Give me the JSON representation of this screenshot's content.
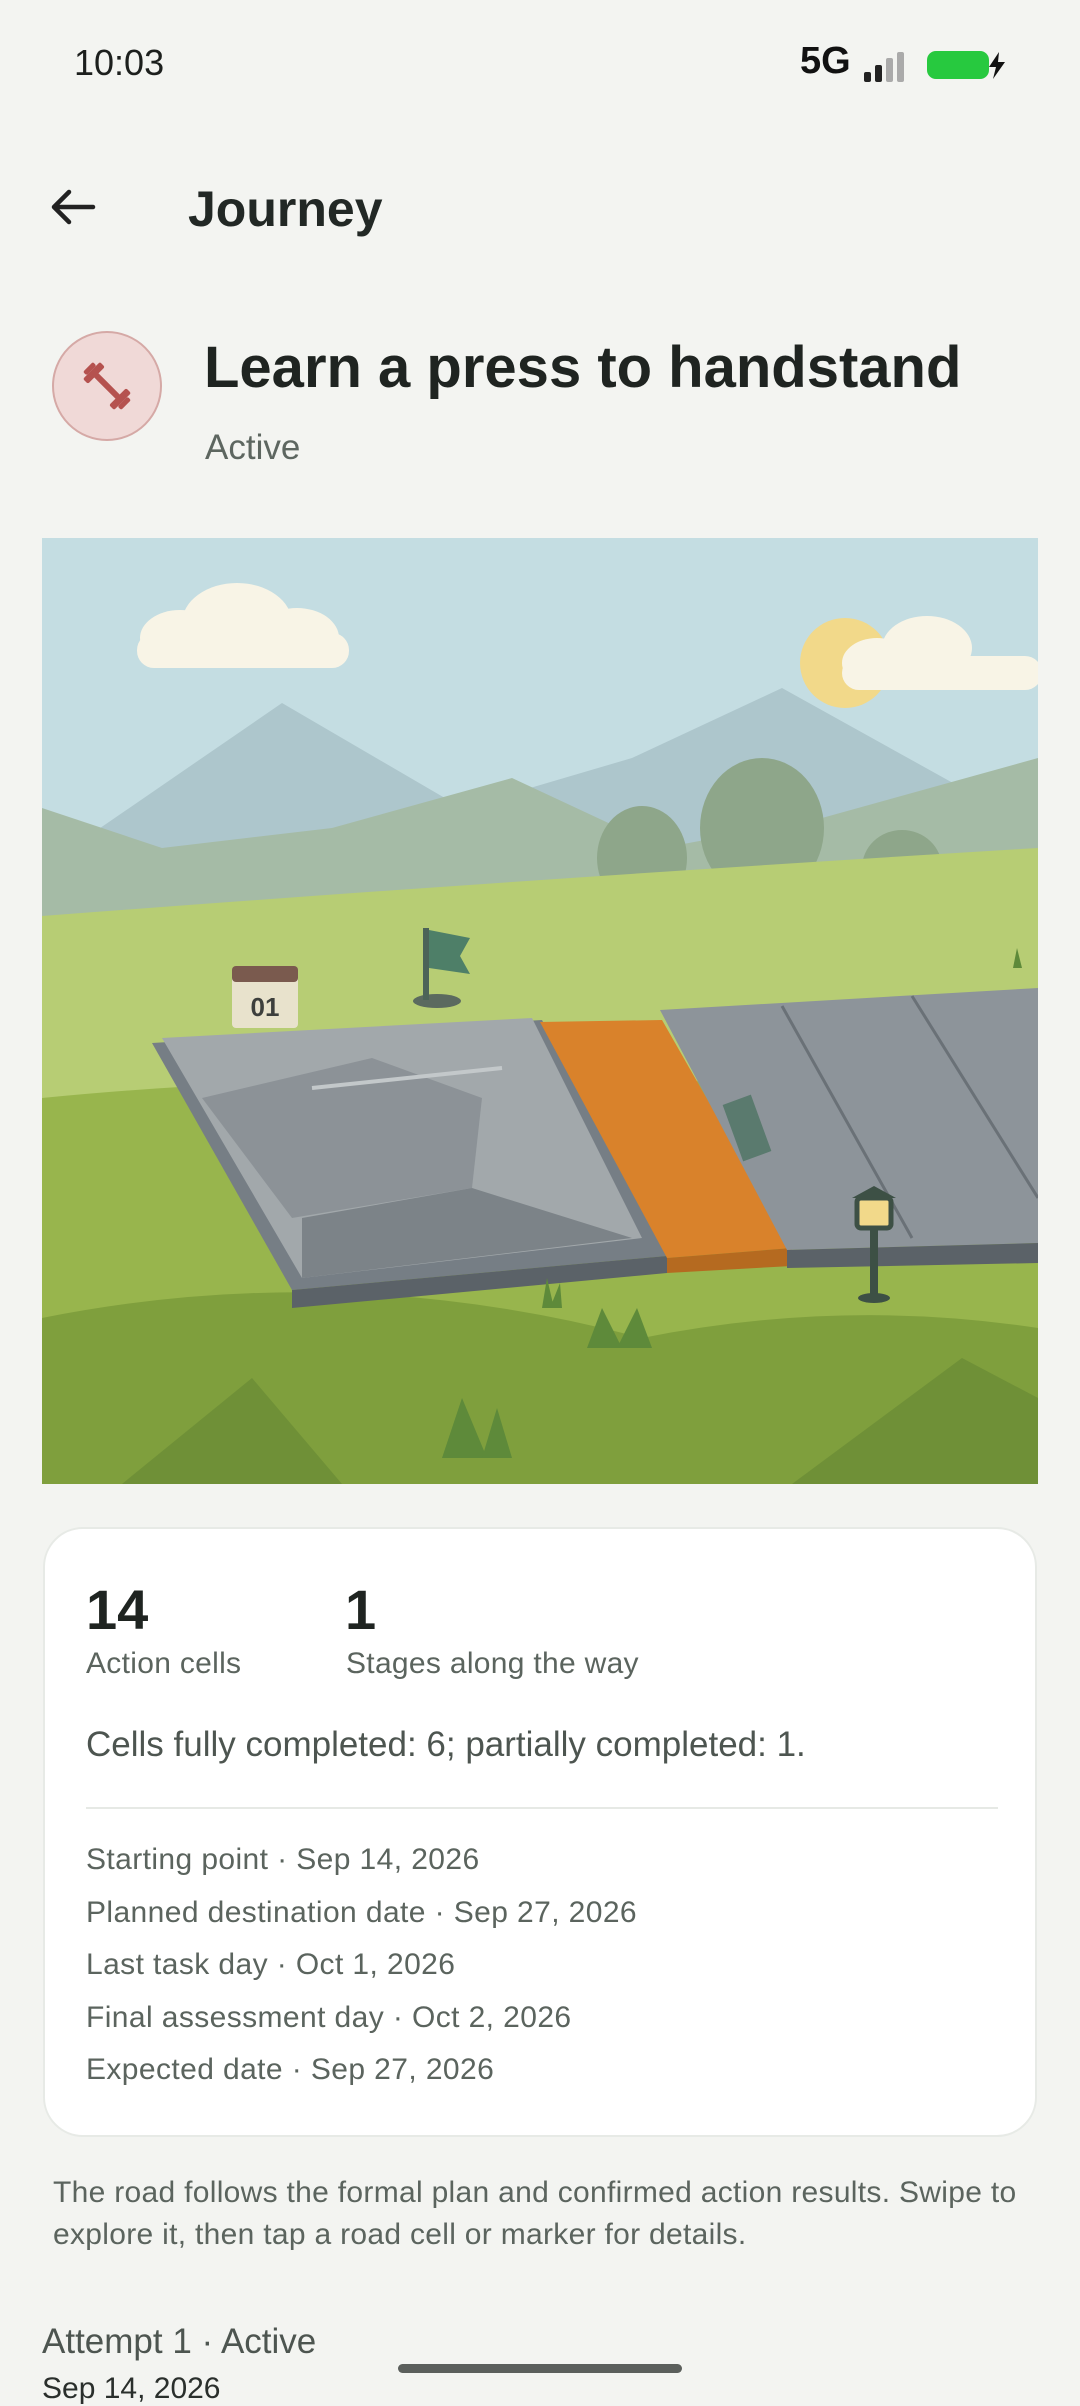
{
  "status_bar": {
    "time": "10:03",
    "network": "5G"
  },
  "app_bar": {
    "title": "Journey",
    "back_icon": "arrow-left-icon"
  },
  "goal": {
    "title": "Learn a press to handstand",
    "status": "Active",
    "icon": "dumbbell-icon",
    "icon_color": "#b5524f"
  },
  "illustration": {
    "marker_label": "01"
  },
  "stats": {
    "action_cells": {
      "value": "14",
      "label": "Action cells"
    },
    "stages": {
      "value": "1",
      "label": "Stages along the way"
    },
    "completion": "Cells fully completed: 6; partially completed: 1."
  },
  "dates": [
    "Starting point · Sep 14, 2026",
    "Planned destination date · Sep 27, 2026",
    "Last task day · Oct 1, 2026",
    "Final assessment day · Oct 2, 2026",
    "Expected date · Sep 27, 2026"
  ],
  "help_text": "The road follows the formal plan and confirmed action results. Swipe to explore it, then tap a road cell or marker for details.",
  "attempt": {
    "title": "Attempt 1 · Active",
    "date": "Sep 14, 2026"
  },
  "colors": {
    "accent_road": "#d9822b",
    "battery": "#27c93f"
  }
}
